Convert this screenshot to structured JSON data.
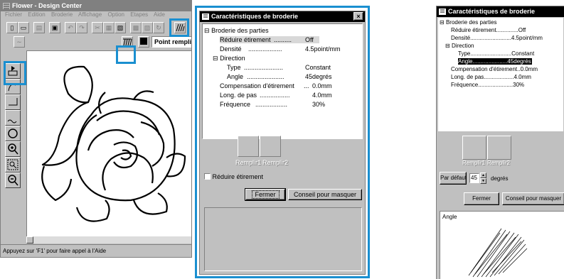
{
  "design_center": {
    "title": "Flower - Design Center",
    "menu": [
      "Fichier",
      "Edition",
      "Broderie",
      "Affichage",
      "Option",
      "Etapes",
      "Aide"
    ],
    "fill_mode": "Point rempli",
    "status": "Appuyez sur 'F1' pour faire appel à l'Aide"
  },
  "dialog": {
    "title": "Caractéristiques de broderie",
    "close": "×",
    "tree": {
      "root": "Broderie des parties",
      "reduce_label": "Réduire étirement",
      "reduce_value": "Off",
      "density_label": "Densité",
      "density_value": "4.5point/mm",
      "direction_label": "Direction",
      "type_label": "Type",
      "type_value": "Constant",
      "angle_label": "Angle",
      "angle_value": "45degrés",
      "comp_label": "Compensation d'étirement",
      "comp_value": "0.0mm",
      "step_label": "Long. de pas",
      "step_value": "4.0mm",
      "freq_label": "Fréquence",
      "freq_value": "30%"
    },
    "parts": [
      "Remplir1",
      "Remplir2"
    ],
    "reduce_checkbox": "Réduire étirement",
    "close_button": "Fermer",
    "tip_button": "Conseil pour masquer"
  },
  "dialog_angle": {
    "title": "Caractéristiques de broderie",
    "default_button": "Par défaut",
    "angle_input": "45",
    "angle_unit": "degrés",
    "close_button": "Fermer",
    "tip_button": "Conseil pour masquer",
    "preview_label": "Angle"
  },
  "colors": {
    "highlight": "#1a8fd0",
    "window_face": "#c0c0c0",
    "title_active": "#000000",
    "title_inactive": "#808080"
  },
  "icons": [
    "flower-app-icon",
    "dialog-app-icon",
    "close-icon",
    "tree-collapse-icon",
    "select-tool-icon",
    "zoom-in-icon",
    "zoom-out-icon",
    "fill-stitch-icon",
    "stitch-pattern-icon",
    "color-swatch-icon"
  ]
}
